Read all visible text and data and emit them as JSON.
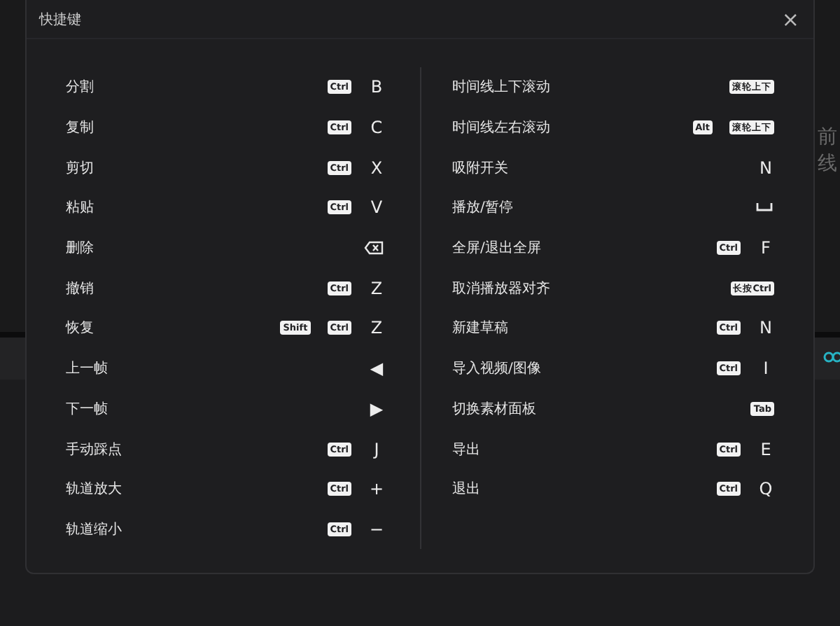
{
  "background": {
    "side_texts": [
      "前",
      "线"
    ]
  },
  "dialog": {
    "title": "快捷键",
    "close": "×",
    "columns": [
      {
        "rows": [
          {
            "label": "分割",
            "keys": [
              {
                "kind": "badge",
                "text": "Ctrl"
              },
              {
                "kind": "char",
                "text": "B"
              }
            ]
          },
          {
            "label": "复制",
            "keys": [
              {
                "kind": "badge",
                "text": "Ctrl"
              },
              {
                "kind": "char",
                "text": "C"
              }
            ]
          },
          {
            "label": "剪切",
            "keys": [
              {
                "kind": "badge",
                "text": "Ctrl"
              },
              {
                "kind": "char",
                "text": "X"
              }
            ]
          },
          {
            "label": "粘贴",
            "keys": [
              {
                "kind": "badge",
                "text": "Ctrl"
              },
              {
                "kind": "char",
                "text": "V"
              }
            ]
          },
          {
            "label": "删除",
            "keys": [
              {
                "kind": "backspace"
              }
            ]
          },
          {
            "label": "撤销",
            "keys": [
              {
                "kind": "badge",
                "text": "Ctrl"
              },
              {
                "kind": "char",
                "text": "Z"
              }
            ]
          },
          {
            "label": "恢复",
            "keys": [
              {
                "kind": "badge",
                "text": "Shift"
              },
              {
                "kind": "badge",
                "text": "Ctrl"
              },
              {
                "kind": "char",
                "text": "Z"
              }
            ]
          },
          {
            "label": "上一帧",
            "keys": [
              {
                "kind": "char",
                "text": "◀"
              }
            ]
          },
          {
            "label": "下一帧",
            "keys": [
              {
                "kind": "char",
                "text": "▶"
              }
            ]
          },
          {
            "label": "手动踩点",
            "keys": [
              {
                "kind": "badge",
                "text": "Ctrl"
              },
              {
                "kind": "char",
                "text": "J"
              }
            ]
          },
          {
            "label": "轨道放大",
            "keys": [
              {
                "kind": "badge",
                "text": "Ctrl"
              },
              {
                "kind": "char",
                "text": "+"
              }
            ]
          },
          {
            "label": "轨道缩小",
            "keys": [
              {
                "kind": "badge",
                "text": "Ctrl"
              },
              {
                "kind": "char",
                "text": "−"
              }
            ]
          }
        ]
      },
      {
        "rows": [
          {
            "label": "时间线上下滚动",
            "keys": [
              {
                "kind": "badge",
                "text": "滚轮上下"
              }
            ]
          },
          {
            "label": "时间线左右滚动",
            "keys": [
              {
                "kind": "badge",
                "text": "Alt"
              },
              {
                "kind": "badge",
                "text": "滚轮上下"
              }
            ]
          },
          {
            "label": "吸附开关",
            "keys": [
              {
                "kind": "char",
                "text": "N"
              }
            ]
          },
          {
            "label": "播放/暂停",
            "keys": [
              {
                "kind": "space"
              }
            ]
          },
          {
            "label": "全屏/退出全屏",
            "keys": [
              {
                "kind": "badge",
                "text": "Ctrl"
              },
              {
                "kind": "char",
                "text": "F"
              }
            ]
          },
          {
            "label": "取消播放器对齐",
            "keys": [
              {
                "kind": "badge",
                "text": "长按Ctrl"
              }
            ]
          },
          {
            "label": "新建草稿",
            "keys": [
              {
                "kind": "badge",
                "text": "Ctrl"
              },
              {
                "kind": "char",
                "text": "N"
              }
            ]
          },
          {
            "label": "导入视频/图像",
            "keys": [
              {
                "kind": "badge",
                "text": "Ctrl"
              },
              {
                "kind": "char",
                "text": "I"
              }
            ]
          },
          {
            "label": "切换素材面板",
            "keys": [
              {
                "kind": "badge",
                "text": "Tab"
              }
            ]
          },
          {
            "label": "导出",
            "keys": [
              {
                "kind": "badge",
                "text": "Ctrl"
              },
              {
                "kind": "char",
                "text": "E"
              }
            ]
          },
          {
            "label": "退出",
            "keys": [
              {
                "kind": "badge",
                "text": "Ctrl"
              },
              {
                "kind": "char",
                "text": "Q"
              }
            ]
          }
        ]
      }
    ]
  }
}
